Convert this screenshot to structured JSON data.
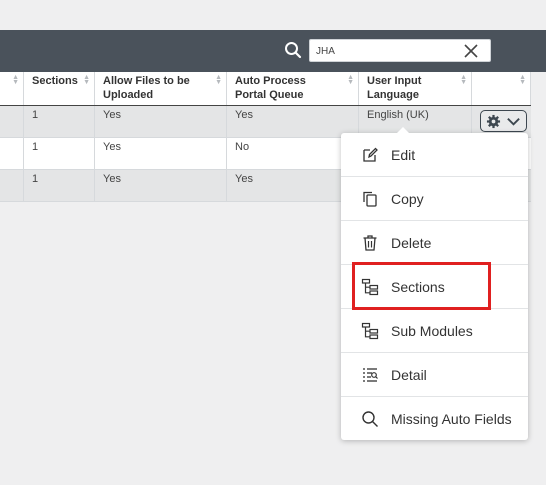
{
  "search": {
    "value": "JHA"
  },
  "table": {
    "headers": [
      {
        "label": "Sections"
      },
      {
        "label": "Allow Files to be Uploaded"
      },
      {
        "label": "Auto Process Portal Queue"
      },
      {
        "label": "User Input Language"
      }
    ],
    "rows": [
      {
        "sections": "1",
        "allow_files": "Yes",
        "auto_process": "Yes",
        "language": "English (UK)"
      },
      {
        "sections": "1",
        "allow_files": "Yes",
        "auto_process": "No",
        "language": ""
      },
      {
        "sections": "1",
        "allow_files": "Yes",
        "auto_process": "Yes",
        "language": ""
      }
    ]
  },
  "menu": {
    "items": [
      {
        "label": "Edit",
        "icon": "edit-icon"
      },
      {
        "label": "Copy",
        "icon": "copy-icon"
      },
      {
        "label": "Delete",
        "icon": "trash-icon"
      },
      {
        "label": "Sections",
        "icon": "hierarchy-icon"
      },
      {
        "label": "Sub Modules",
        "icon": "hierarchy-icon"
      },
      {
        "label": "Detail",
        "icon": "detail-list-icon"
      },
      {
        "label": "Missing Auto Fields",
        "icon": "search-icon"
      }
    ]
  },
  "colors": {
    "topbar": "#4a525b",
    "highlight": "#e02020",
    "row_shaded": "#e4e5e6"
  }
}
